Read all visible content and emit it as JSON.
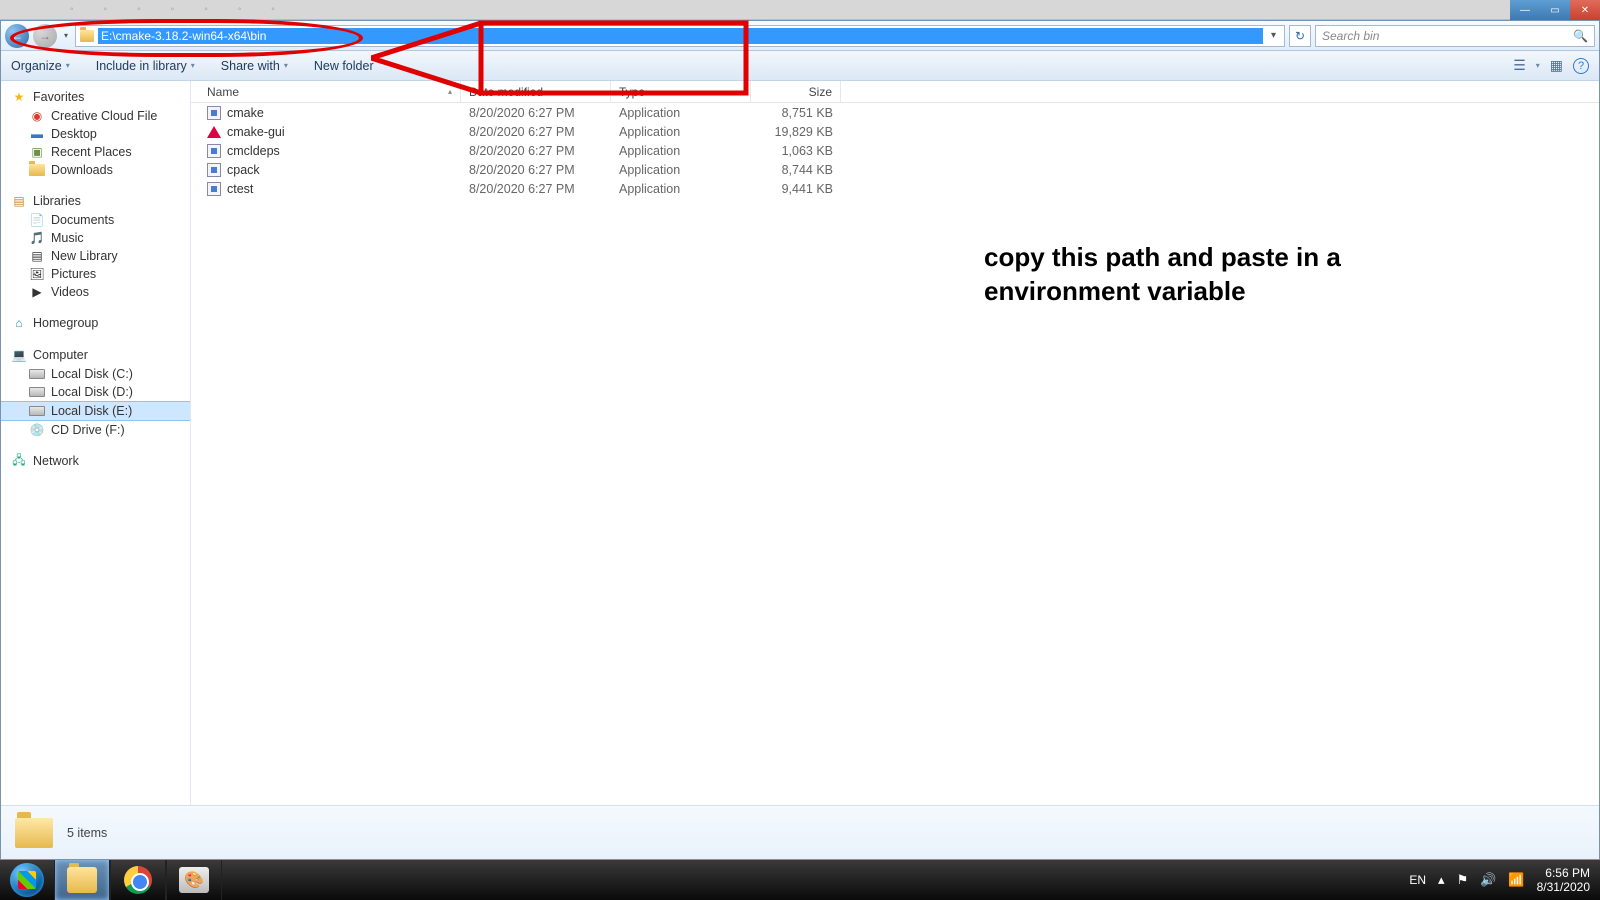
{
  "window_controls": {
    "min": "—",
    "max": "▭",
    "close": "✕"
  },
  "address_bar": {
    "path": "E:\\cmake-3.18.2-win64-x64\\bin",
    "dropdown": "▾",
    "refresh": "↻"
  },
  "search": {
    "placeholder": "Search bin",
    "icon": "🔍"
  },
  "toolbar": {
    "organize": "Organize",
    "include": "Include in library",
    "share": "Share with",
    "newfolder": "New folder",
    "view_icon": "☰",
    "preview_icon": "▦",
    "help_icon": "?"
  },
  "sidebar": {
    "favorites": {
      "head": "Favorites",
      "items": [
        {
          "icon": "cloud",
          "label": "Creative Cloud File"
        },
        {
          "icon": "desktop",
          "label": "Desktop"
        },
        {
          "icon": "recent",
          "label": "Recent Places"
        },
        {
          "icon": "dl",
          "label": "Downloads"
        }
      ]
    },
    "libraries": {
      "head": "Libraries",
      "items": [
        {
          "label": "Documents"
        },
        {
          "label": "Music"
        },
        {
          "label": "New Library"
        },
        {
          "label": "Pictures"
        },
        {
          "label": "Videos"
        }
      ]
    },
    "homegroup": {
      "head": "Homegroup"
    },
    "computer": {
      "head": "Computer",
      "items": [
        {
          "label": "Local Disk (C:)"
        },
        {
          "label": "Local Disk (D:)"
        },
        {
          "label": "Local Disk (E:)",
          "selected": true
        },
        {
          "label": "CD Drive (F:)"
        }
      ]
    },
    "network": {
      "head": "Network"
    }
  },
  "columns": {
    "name": "Name",
    "date": "Date modified",
    "type": "Type",
    "size": "Size"
  },
  "files": [
    {
      "name": "cmake",
      "date": "8/20/2020 6:27 PM",
      "type": "Application",
      "size": "8,751 KB",
      "icon": "app"
    },
    {
      "name": "cmake-gui",
      "date": "8/20/2020 6:27 PM",
      "type": "Application",
      "size": "19,829 KB",
      "icon": "tri"
    },
    {
      "name": "cmcldeps",
      "date": "8/20/2020 6:27 PM",
      "type": "Application",
      "size": "1,063 KB",
      "icon": "app"
    },
    {
      "name": "cpack",
      "date": "8/20/2020 6:27 PM",
      "type": "Application",
      "size": "8,744 KB",
      "icon": "app"
    },
    {
      "name": "ctest",
      "date": "8/20/2020 6:27 PM",
      "type": "Application",
      "size": "9,441 KB",
      "icon": "app"
    }
  ],
  "details": {
    "count": "5 items"
  },
  "annotation": {
    "line1": "copy this path and paste in a",
    "line2": "environment variable"
  },
  "tray": {
    "lang": "EN",
    "up": "▴",
    "flag": "⚑",
    "vol": "🔊",
    "net": "📶",
    "time": "6:56 PM",
    "date": "8/31/2020"
  }
}
